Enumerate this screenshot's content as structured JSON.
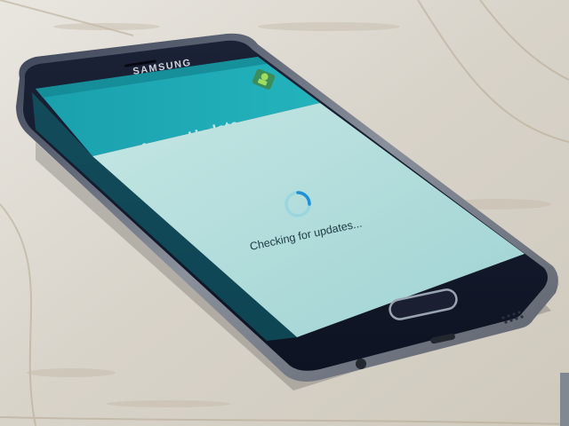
{
  "device": {
    "brand": "SAMSUNG"
  },
  "screen": {
    "title": "Software Update",
    "status": "Checking for updates..."
  },
  "colors": {
    "header_teal": "#1aa2b0",
    "screen_body": "#bfe3e1",
    "phone_frame": "#101522",
    "wood": "#d9d5cc"
  },
  "icons": {
    "app_icon": "android-update-icon",
    "spinner": "loading-spinner-icon",
    "home": "home-button"
  }
}
